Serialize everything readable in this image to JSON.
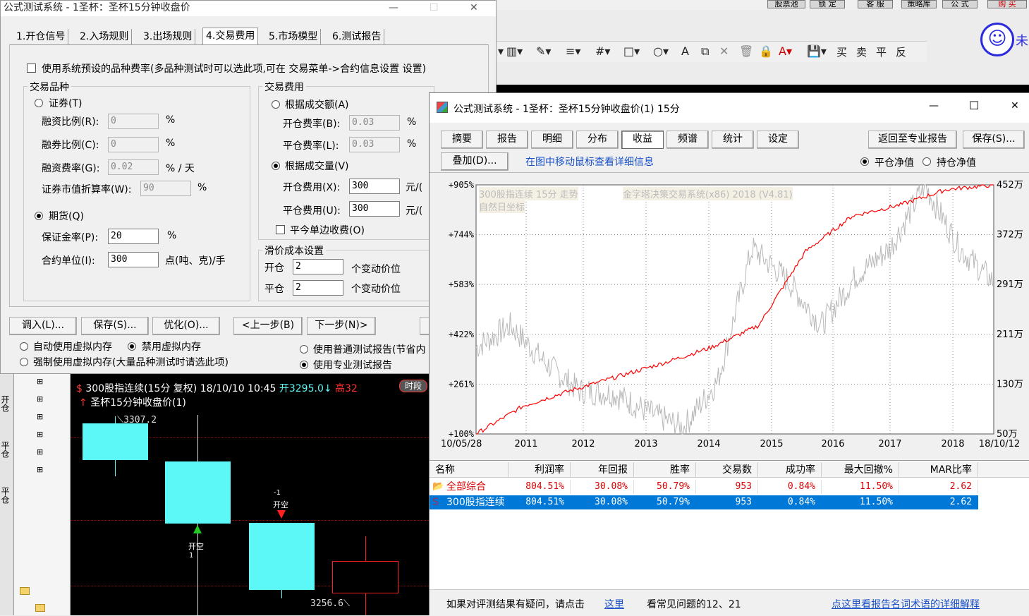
{
  "top_right": {
    "buttons": [
      "股票池",
      "锁 定",
      "客 服",
      "策略库",
      "公 式",
      "购 买"
    ],
    "toolbar_icons": [
      "line-style-icon",
      "pen-icon",
      "column-icon",
      "grid-icon",
      "rect-icon",
      "circle-icon",
      "text-a-icon",
      "copy-icon",
      "delete-icon",
      "lock-icon",
      "color-a-icon",
      "save-icon"
    ],
    "toolbar_text": [
      "买",
      "卖",
      "平",
      "反"
    ],
    "avatar_text": "未"
  },
  "main_dialog": {
    "title": "公式测试系统 - 1圣杯：圣杯15分钟收盘价",
    "tabs": [
      "1.开仓信号",
      "2.入场规则",
      "3.出场规则",
      "4.交易费用",
      "5.市场模型",
      "6.测试报告"
    ],
    "checkbox_preset": "使用系统预设的品种费率(多品种测试时可以选此项,可在 交易菜单->合约信息设置 设置)",
    "variety_group": "交易品种",
    "stock_radio": "证券(T)",
    "margin_ratio_label": "融资比例(R):",
    "margin_ratio": "0",
    "short_ratio_label": "融券比例(C):",
    "short_ratio": "0",
    "finance_fee_label": "融资费率(G):",
    "finance_fee": "0.02",
    "finance_fee_unit": "% / 天",
    "discount_label": "证券市值折算率(W):",
    "discount": "90",
    "pct": "%",
    "futures_radio": "期货(Q)",
    "deposit_label": "保证金率(P):",
    "deposit": "20",
    "contract_label": "合约单位(I):",
    "contract": "300",
    "contract_unit": "点(吨、克)/手",
    "fee_group": "交易费用",
    "by_amount_radio": "根据成交额(A)",
    "open_rate_label": "开仓费率(B):",
    "open_rate": "0.03",
    "close_rate_label": "平仓费率(L):",
    "close_rate": "0.03",
    "by_volume_radio": "根据成交量(V)",
    "open_fee_label": "开仓费用(X):",
    "open_fee": "300",
    "close_fee_label": "平仓费用(U):",
    "close_fee": "300",
    "fee_unit": "元/(",
    "single_side": "平今单边收费(O)",
    "slip_group": "滑价成本设置",
    "slip_open_label": "开仓",
    "slip_open": "2",
    "slip_close_label": "平仓",
    "slip_close": "2",
    "slip_unit": "个变动价位",
    "buttons": [
      "调入(L)...",
      "保存(S)...",
      "优化(O)...",
      "<上一步(B)",
      "下一步(N)>"
    ],
    "vm_auto": "自动使用虚拟内存",
    "vm_off": "禁用虚拟内存",
    "vm_force": "强制使用虚拟内存(大量品种测试时请选此项)",
    "report_normal": "使用普通测试报告(节省内",
    "report_pro": "使用专业测试报告"
  },
  "kchart": {
    "symbol_line": "300股指连续(15分 复权) 18/10/10 10:45",
    "open_text": "开3295.0",
    "high_text": "高32",
    "period_badge": "时段",
    "indicator_line": "圣杯15分钟收盘价(1)",
    "hi_label": "3307.2",
    "lo_label": "3256.6",
    "sig1_top": "-1",
    "sig1_text": "开空",
    "sig2_text": "开空",
    "sig2_sub": "1",
    "left_tabs": [
      "开仓",
      "平仓",
      "平仓"
    ]
  },
  "report": {
    "title": "公式测试系统 - 1圣杯：圣杯15分钟收盘价(1) 15分",
    "tabs": [
      "摘要",
      "报告",
      "明细",
      "分布",
      "收益",
      "频谱",
      "统计",
      "设定"
    ],
    "btn_pro": "返回至专业报告",
    "btn_save": "保存(S)...",
    "btn_overlay": "叠加(D)...",
    "hint_link": "在图中移动鼠标查看详细信息",
    "radio_close_nav": "平仓净值",
    "radio_hold_nav": "持仓净值",
    "chart_note1": "300股指连续 15分 走势",
    "chart_note2": "自然日坐标",
    "chart_watermark": "金字塔决策交易系统(x86) 2018 (V4.81)",
    "table": {
      "headers": [
        "名称",
        "利润率",
        "年回报",
        "胜率",
        "交易数",
        "成功率",
        "最大回撤%",
        "MAR比率"
      ],
      "rows": [
        {
          "name": "全部综合",
          "values": [
            "804.51%",
            "30.08%",
            "50.79%",
            "953",
            "0.84%",
            "11.50%",
            "2.62"
          ]
        },
        {
          "name": "300股指连续",
          "values": [
            "804.51%",
            "30.08%",
            "50.79%",
            "953",
            "0.84%",
            "11.50%",
            "2.62"
          ]
        }
      ]
    },
    "footer_q": "如果对评测结果有疑问，请点击",
    "footer_here": "这里",
    "footer_faq": "看常见问题的12、21",
    "footer_terms": "点这里看报告名词术语的详细解释"
  },
  "chart_data": {
    "type": "line",
    "x": [
      "10/05/28",
      "2011",
      "2012",
      "2013",
      "2014",
      "2015",
      "2016",
      "2017",
      "2018",
      "18/10/12"
    ],
    "y_left_ticks": [
      "+905%",
      "+744%",
      "+583%",
      "+422%",
      "+261%",
      "+100%"
    ],
    "y_right_ticks": [
      "452万",
      "372万",
      "291万",
      "211万",
      "130万",
      "50万"
    ],
    "series": [
      {
        "color": "#ff0000",
        "values": [
          100,
          190,
          240,
          285,
          330,
          380,
          450,
          690,
          805,
          840,
          890,
          905
        ]
      },
      {
        "color": "#b8b8b8",
        "values": [
          380,
          450,
          330,
          240,
          230,
          170,
          120,
          270,
          700,
          600,
          450,
          610,
          700,
          905,
          700,
          590
        ]
      }
    ]
  },
  "colors": {
    "accent": "#1a6fd4",
    "candle": "#5cf7f7",
    "red": "#ff0000",
    "select": "#0078d7"
  }
}
